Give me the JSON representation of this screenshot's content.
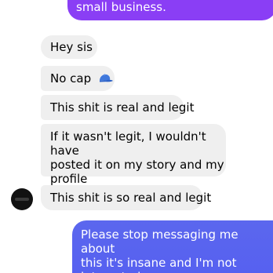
{
  "thread": {
    "top_outgoing": "small business.",
    "incoming": [
      {
        "text": "Hey sis"
      },
      {
        "text": "No cap",
        "emoji": "blue-cap-icon"
      },
      {
        "text": "This shit is real and legit"
      },
      {
        "lines": [
          "If it wasn't legit, I wouldn't have",
          "posted it on my story and my",
          "profile"
        ]
      },
      {
        "text": "This shit is so real and legit"
      }
    ],
    "bottom_outgoing": {
      "lines": [
        "Please stop messaging me about",
        "this it's insane and I'm not",
        "interested"
      ]
    }
  },
  "colors": {
    "incoming_bubble": "#efefef",
    "outgoing_top": "#8a3ef5",
    "outgoing_bottom": "#5a64ef",
    "cap": "#4a7fe0"
  }
}
